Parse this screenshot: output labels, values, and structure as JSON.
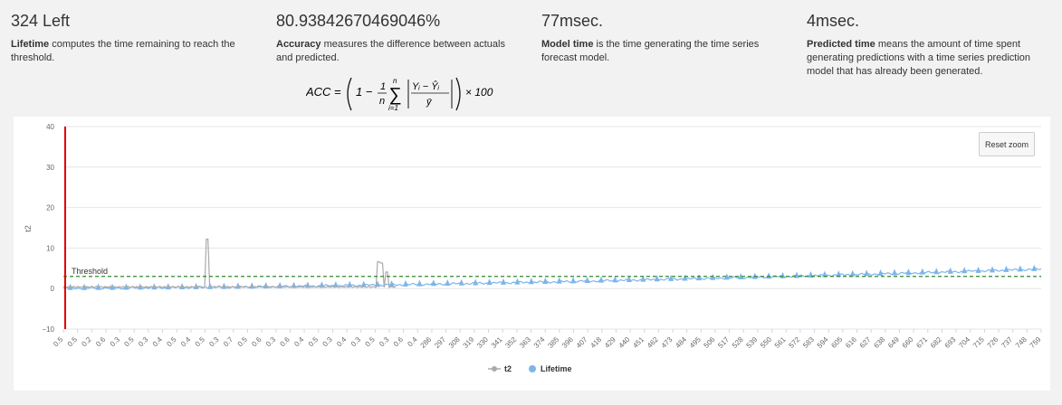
{
  "stats": [
    {
      "value": "324 Left",
      "term": "Lifetime",
      "desc": " computes the time remaining to reach the threshold."
    },
    {
      "value": "80.93842670469046%",
      "term": "Accuracy",
      "desc": " measures the difference between actuals and predicted."
    },
    {
      "value": "77msec.",
      "term": "Model time",
      "desc": " is the time generating the time series forecast model."
    },
    {
      "value": "4msec.",
      "term": "Predicted time",
      "desc": " means the amount of time spent generating predictions with a time series prediction model that has already been generated."
    }
  ],
  "formula": {
    "lhs": "ACC =",
    "one": "1 −",
    "frac_num": "1",
    "frac_den": "n",
    "sum_top": "n",
    "sum_bottom": "i=1",
    "abs_num": "Yᵢ − Ŷᵢ",
    "abs_den": "ȳ",
    "times": "× 100"
  },
  "reset_zoom_label": "Reset zoom",
  "chart_data": {
    "type": "line",
    "ylabel": "t2",
    "ylim": [
      -10,
      40
    ],
    "yticks": [
      "40",
      "30",
      "20",
      "10",
      "0",
      "−10"
    ],
    "threshold": {
      "label": "Threshold",
      "value": 3,
      "color": "#2e8b2e"
    },
    "marker_color": "#e00000",
    "x_ticks": [
      "0.5",
      "0.5",
      "0.2",
      "0.6",
      "0.3",
      "0.5",
      "0.3",
      "0.4",
      "0.5",
      "0.4",
      "0.5",
      "0.3",
      "0.7",
      "0.5",
      "0.6",
      "0.3",
      "0.6",
      "0.4",
      "0.5",
      "0.3",
      "0.4",
      "0.3",
      "0.5",
      "0.3",
      "0.6",
      "0.4",
      "286",
      "297",
      "308",
      "319",
      "330",
      "341",
      "352",
      "363",
      "374",
      "385",
      "396",
      "407",
      "418",
      "429",
      "440",
      "451",
      "462",
      "473",
      "484",
      "495",
      "506",
      "517",
      "528",
      "539",
      "550",
      "561",
      "572",
      "583",
      "594",
      "605",
      "616",
      "627",
      "638",
      "649",
      "660",
      "671",
      "682",
      "693",
      "704",
      "715",
      "726",
      "737",
      "748",
      "759"
    ],
    "series": [
      {
        "name": "t2",
        "color": "#aaaaaa",
        "baseline": 0.4,
        "spikes": [
          {
            "at": 0.147,
            "value": 12.2
          },
          {
            "at": 0.323,
            "value": 6.6
          },
          {
            "at": 0.326,
            "value": 6.3
          },
          {
            "at": 0.331,
            "value": 4.1
          }
        ],
        "range": [
          0.0,
          0.34
        ]
      },
      {
        "name": "Lifetime",
        "color": "#7cb5ec",
        "start": 0.1,
        "end": 4.8,
        "range": [
          0.0,
          1.0
        ]
      }
    ],
    "legend": "bottom-center"
  }
}
